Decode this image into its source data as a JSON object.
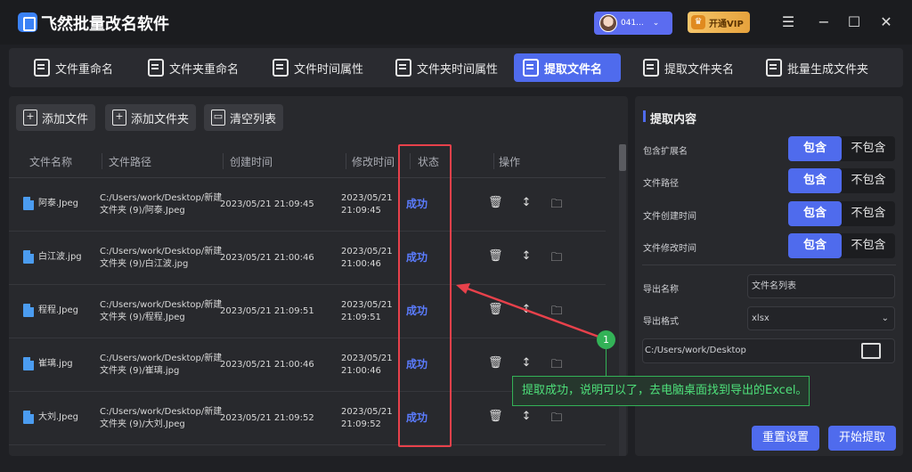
{
  "app": {
    "title": "飞然批量改名软件"
  },
  "user": {
    "name": "041..."
  },
  "vip": {
    "label": "开通VIP"
  },
  "tabs": [
    {
      "label": "文件重命名",
      "icon": "file-rename-icon"
    },
    {
      "label": "文件夹重命名",
      "icon": "folder-rename-icon"
    },
    {
      "label": "文件时间属性",
      "icon": "file-time-icon"
    },
    {
      "label": "文件夹时间属性",
      "icon": "folder-time-icon"
    },
    {
      "label": "提取文件名",
      "icon": "extract-filename-icon",
      "active": true
    },
    {
      "label": "提取文件夹名",
      "icon": "extract-foldername-icon"
    },
    {
      "label": "批量生成文件夹",
      "icon": "generate-folder-icon"
    }
  ],
  "toolbar": {
    "add_file": "添加文件",
    "add_folder": "添加文件夹",
    "clear_list": "清空列表"
  },
  "table": {
    "headers": [
      "文件名称",
      "文件路径",
      "创建时间",
      "修改时间",
      "状态",
      "操作"
    ],
    "rows": [
      {
        "name": "阿泰.Jpeg",
        "path1": "C:/Users/work/Desktop/新建",
        "path2": "文件夹 (9)/阿泰.Jpeg",
        "created": "2023/05/21 21:09:45",
        "mod1": "2023/05/21",
        "mod2": "21:09:45",
        "status": "成功"
      },
      {
        "name": "白江波.jpg",
        "path1": "C:/Users/work/Desktop/新建",
        "path2": "文件夹 (9)/白江波.jpg",
        "created": "2023/05/21 21:00:46",
        "mod1": "2023/05/21",
        "mod2": "21:00:46",
        "status": "成功"
      },
      {
        "name": "程程.Jpeg",
        "path1": "C:/Users/work/Desktop/新建",
        "path2": "文件夹 (9)/程程.Jpeg",
        "created": "2023/05/21 21:09:51",
        "mod1": "2023/05/21",
        "mod2": "21:09:51",
        "status": "成功"
      },
      {
        "name": "崔璃.jpg",
        "path1": "C:/Users/work/Desktop/新建",
        "path2": "文件夹 (9)/崔璃.jpg",
        "created": "2023/05/21 21:00:46",
        "mod1": "2023/05/21",
        "mod2": "21:00:46",
        "status": "成功"
      },
      {
        "name": "大刘.Jpeg",
        "path1": "C:/Users/work/Desktop/新建",
        "path2": "文件夹 (9)/大刘.Jpeg",
        "created": "2023/05/21 21:09:52",
        "mod1": "2023/05/21",
        "mod2": "21:09:52",
        "status": "成功"
      }
    ]
  },
  "settings": {
    "title": "提取内容",
    "options": [
      {
        "label": "包含扩展名",
        "on": "包含",
        "off": "不包含"
      },
      {
        "label": "文件路径",
        "on": "包含",
        "off": "不包含"
      },
      {
        "label": "文件创建时间",
        "on": "包含",
        "off": "不包含"
      },
      {
        "label": "文件修改时间",
        "on": "包含",
        "off": "不包含"
      }
    ],
    "export_name_label": "导出名称",
    "export_name_value": "文件名列表",
    "export_format_label": "导出格式",
    "export_format_value": "xlsx",
    "export_path": "C:/Users/work/Desktop",
    "reset_label": "重置设置",
    "start_label": "开始提取"
  },
  "annotation": {
    "badge": "1",
    "text": "提取成功，说明可以了，去电脑桌面找到导出的Excel。"
  },
  "colors": {
    "accent": "#4f6bed",
    "status_success": "#5b7cff",
    "highlight_red": "#e8414b",
    "callout_green": "#33b257"
  }
}
